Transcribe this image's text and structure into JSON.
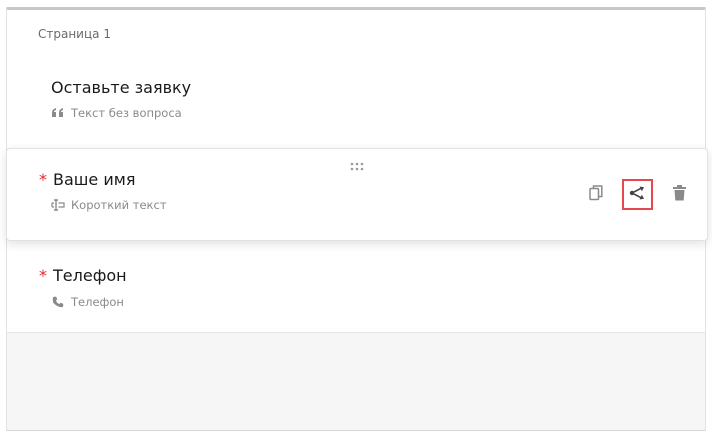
{
  "page": {
    "label": "Страница 1"
  },
  "questions": [
    {
      "title": "Оставьте заявку",
      "required": false,
      "type_label": "Текст без вопроса",
      "type_icon": "quote-icon"
    },
    {
      "title": "Ваше имя",
      "required": true,
      "required_mark": "*",
      "type_label": "Короткий текст",
      "type_icon": "text-cursor-icon",
      "selected": true
    },
    {
      "title": "Телефон",
      "required": true,
      "required_mark": "*",
      "type_label": "Телефон",
      "type_icon": "phone-icon"
    }
  ],
  "question_actions": [
    {
      "name": "copy",
      "icon": "copy-icon"
    },
    {
      "name": "logic",
      "icon": "logic-branch-icon",
      "highlighted": true,
      "highlight_color": "#e5484d"
    },
    {
      "name": "delete",
      "icon": "trash-icon"
    }
  ],
  "colors": {
    "required": "#e3282a",
    "highlight": "#e5484d",
    "icon": "#8a8a8a"
  }
}
